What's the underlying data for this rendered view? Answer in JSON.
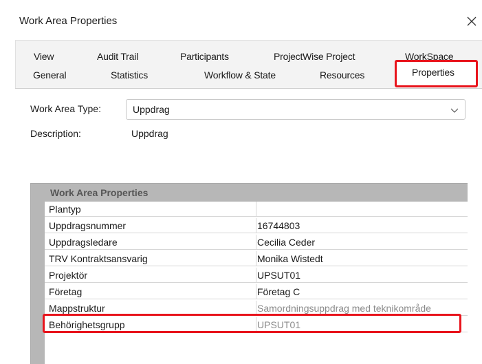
{
  "window": {
    "title": "Work Area Properties",
    "close_icon": "close-icon"
  },
  "tabs_row1": [
    "View",
    "Audit Trail",
    "Participants",
    "ProjectWise Project",
    "WorkSpace"
  ],
  "tabs_row2": [
    "General",
    "Statistics",
    "Workflow & State",
    "Resources",
    "Properties"
  ],
  "active_tab": "Properties",
  "form": {
    "type_label": "Work Area Type:",
    "type_value": "Uppdrag",
    "description_label": "Description:",
    "description_value": "Uppdrag"
  },
  "grid": {
    "header": "Work Area Properties",
    "rows": [
      {
        "name": "Plantyp",
        "value": ""
      },
      {
        "name": "Uppdragsnummer",
        "value": "16744803"
      },
      {
        "name": "Uppdragsledare",
        "value": "Cecilia Ceder"
      },
      {
        "name": "TRV Kontraktsansvarig",
        "value": "Monika Wistedt"
      },
      {
        "name": "Projektör",
        "value": "UPSUT01"
      },
      {
        "name": "Företag",
        "value": "Företag C"
      },
      {
        "name": "Mappstruktur",
        "value": "Samordningsuppdrag med teknikområde"
      },
      {
        "name": "Behörighetsgrupp",
        "value": "UPSUT01"
      }
    ]
  },
  "colors": {
    "highlight": "#e8141c",
    "grid_header": "#b7b7b7",
    "dim_text": "#8a8a8a"
  }
}
